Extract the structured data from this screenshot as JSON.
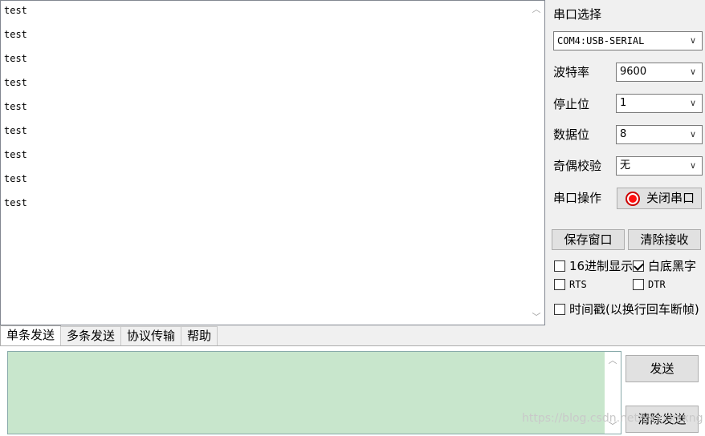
{
  "receive": {
    "lines": [
      "test",
      "test",
      "test",
      "test",
      "test",
      "test",
      "test",
      "test",
      "test"
    ]
  },
  "serial": {
    "port_label": "串口选择",
    "port_value": "COM4:USB-SERIAL",
    "baud_label": "波特率",
    "baud_value": "9600",
    "stop_label": "停止位",
    "stop_value": "1",
    "data_label": "数据位",
    "data_value": "8",
    "parity_label": "奇偶校验",
    "parity_value": "无",
    "op_label": "串口操作",
    "op_button": "关闭串口",
    "led_color": "#ff1010"
  },
  "actions": {
    "save_window": "保存窗口",
    "clear_receive": "清除接收"
  },
  "options": {
    "hex_display": {
      "label": "16进制显示",
      "checked": false
    },
    "white_bg": {
      "label": "白底黑字",
      "checked": true
    },
    "rts": {
      "label": "RTS",
      "checked": false
    },
    "dtr": {
      "label": "DTR",
      "checked": false
    },
    "timestamp": {
      "label": "时间戳(以换行回车断帧)",
      "checked": false
    }
  },
  "tabs": [
    "单条发送",
    "多条发送",
    "协议传输",
    "帮助"
  ],
  "send": {
    "send_button": "发送",
    "clear_send_button": "清除发送",
    "bg_color": "#c8e6cc"
  },
  "watermark": "https://blog.csdn.net/xxxxxxxng"
}
